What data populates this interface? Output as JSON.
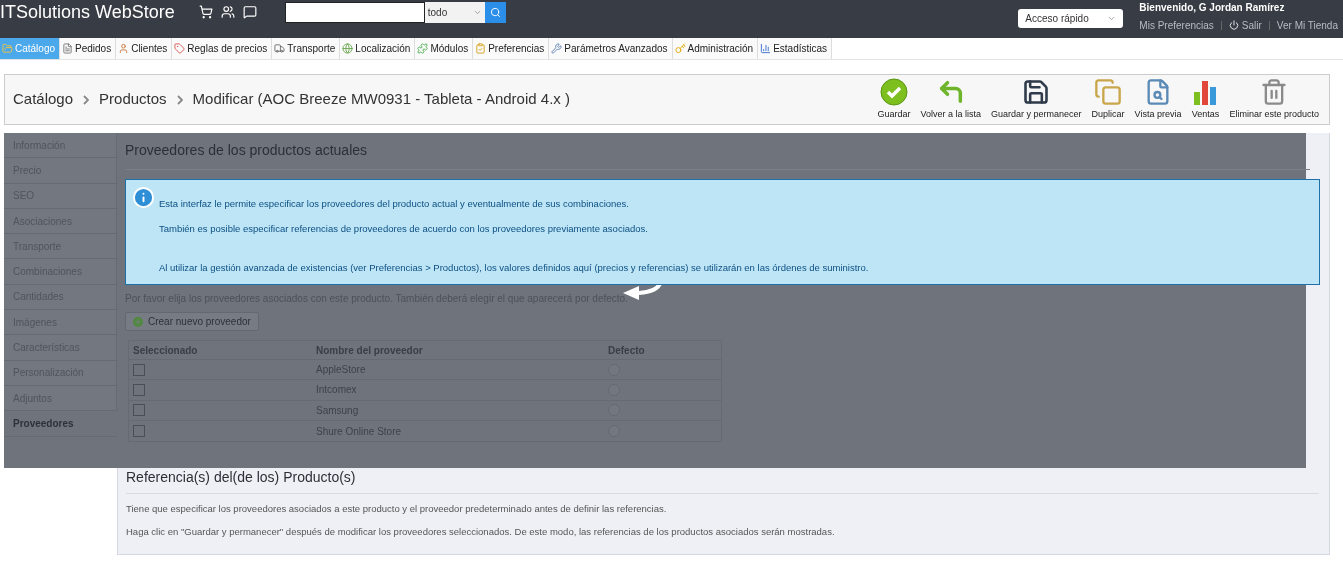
{
  "header": {
    "title": "ITSolutions WebStore",
    "search_scope": "todo",
    "quick_access": "Acceso rápido",
    "welcome": "Bienvenido, G Jordan Ramírez",
    "links": [
      "Mis Preferencias",
      "Salir",
      "Ver Mi Tienda"
    ]
  },
  "tabs": [
    {
      "label": "Catálogo",
      "selected": true
    },
    {
      "label": "Pedidos",
      "selected": false
    },
    {
      "label": "Clientes",
      "selected": false
    },
    {
      "label": "Reglas de precios",
      "selected": false
    },
    {
      "label": "Transporte",
      "selected": false
    },
    {
      "label": "Localización",
      "selected": false
    },
    {
      "label": "Módulos",
      "selected": false
    },
    {
      "label": "Preferencias",
      "selected": false
    },
    {
      "label": "Parámetros Avanzados",
      "selected": false
    },
    {
      "label": "Administración",
      "selected": false
    },
    {
      "label": "Estadísticas",
      "selected": false
    }
  ],
  "breadcrumb": [
    "Catálogo",
    "Productos",
    "Modificar (AOC Breeze MW0931 - Tableta - Android 4.x )"
  ],
  "toolbar": [
    "Guardar",
    "Volver a la lista",
    "Guardar y permanecer",
    "Duplicar",
    "Vista previa",
    "Ventas",
    "Eliminar este producto"
  ],
  "sidebar": [
    {
      "label": "Información",
      "selected": false
    },
    {
      "label": "Precio",
      "selected": false
    },
    {
      "label": "SEO",
      "selected": false
    },
    {
      "label": "Asociaciones",
      "selected": false
    },
    {
      "label": "Transporte",
      "selected": false
    },
    {
      "label": "Combinaciones",
      "selected": false
    },
    {
      "label": "Cantidades",
      "selected": false
    },
    {
      "label": "Imágenes",
      "selected": false
    },
    {
      "label": "Características",
      "selected": false
    },
    {
      "label": "Personalización",
      "selected": false
    },
    {
      "label": "Adjuntos",
      "selected": false
    },
    {
      "label": "Proveedores",
      "selected": true
    }
  ],
  "suppliers": {
    "title": "Proveedores de los productos actuales",
    "info": [
      "Esta interfaz le permite especificar los proveedores del producto actual y eventualmente de sus combinaciones.",
      "También es posible especificar referencias de proveedores de acuerdo con los proveedores previamente asociados.",
      "Al utilizar la gestión avanzada de existencias (ver Preferencias > Productos), los valores definidos aquí (precios y referencias) se utilizarán en las órdenes de suministro."
    ],
    "hint": "Por favor elija los proveedores asociados con este producto. También deberá elegir el que aparecerá por defecto.",
    "create_button": "Crear nuevo proveedor",
    "columns": [
      "Seleccionado",
      "Nombre del proveedor",
      "Defecto"
    ],
    "rows": [
      {
        "name": "AppleStore",
        "checked": false,
        "default": false
      },
      {
        "name": "Intcomex",
        "checked": false,
        "default": false
      },
      {
        "name": "Samsung",
        "checked": false,
        "default": false
      },
      {
        "name": "Shure Online Store",
        "checked": false,
        "default": false
      }
    ]
  },
  "references": {
    "title": "Referencia(s) del(de los) Producto(s)",
    "notes": [
      "Tiene que especificar los proveedores asociados a este producto y el proveedor predeterminado antes de definir las referencias.",
      "Haga clic en \"Guardar y permanecer\" después de modificar los proveedores seleccionados. De este modo, las referencias de los productos asociados serán mostradas."
    ]
  }
}
